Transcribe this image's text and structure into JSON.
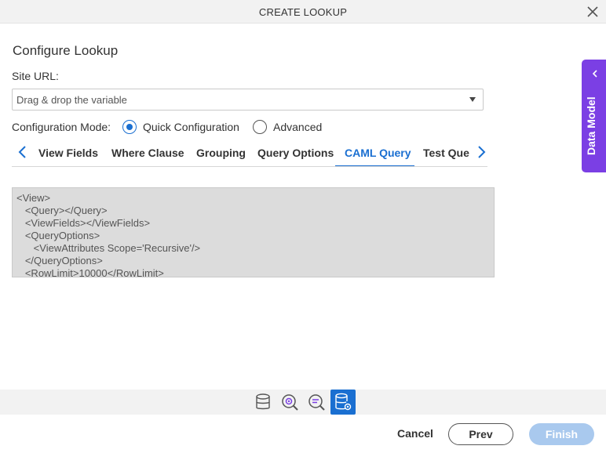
{
  "dialog": {
    "title": "CREATE LOOKUP"
  },
  "page": {
    "heading": "Configure Lookup"
  },
  "site_url": {
    "label": "Site URL:",
    "placeholder": "Drag & drop the variable"
  },
  "configuration_mode": {
    "label": "Configuration Mode:",
    "options": [
      {
        "label": "Quick Configuration",
        "selected": true
      },
      {
        "label": "Advanced",
        "selected": false
      }
    ]
  },
  "tabs": [
    {
      "label": "View Fields",
      "active": false
    },
    {
      "label": "Where Clause",
      "active": false
    },
    {
      "label": "Grouping",
      "active": false
    },
    {
      "label": "Query Options",
      "active": false
    },
    {
      "label": "CAML Query",
      "active": true
    },
    {
      "label": "Test Que",
      "active": false
    }
  ],
  "caml_query": {
    "lines": [
      "<View>",
      "   <Query></Query>",
      "   <ViewFields></ViewFields>",
      "   <QueryOptions>",
      "      <ViewAttributes Scope='Recursive'/>",
      "   </QueryOptions>",
      "   <RowLimit>10000</RowLimit>"
    ]
  },
  "side_panel": {
    "label": "Data Model"
  },
  "bottom_icons": [
    {
      "name": "database-icon",
      "active": false
    },
    {
      "name": "search-settings-icon",
      "active": false
    },
    {
      "name": "filter-list-icon",
      "active": false
    },
    {
      "name": "database-settings-icon",
      "active": true
    }
  ],
  "footer": {
    "cancel": "Cancel",
    "prev": "Prev",
    "finish": "Finish"
  },
  "colors": {
    "accent": "#1a6fd1",
    "side_panel": "#7b3fe4",
    "finish_disabled": "#a9c9ee"
  }
}
